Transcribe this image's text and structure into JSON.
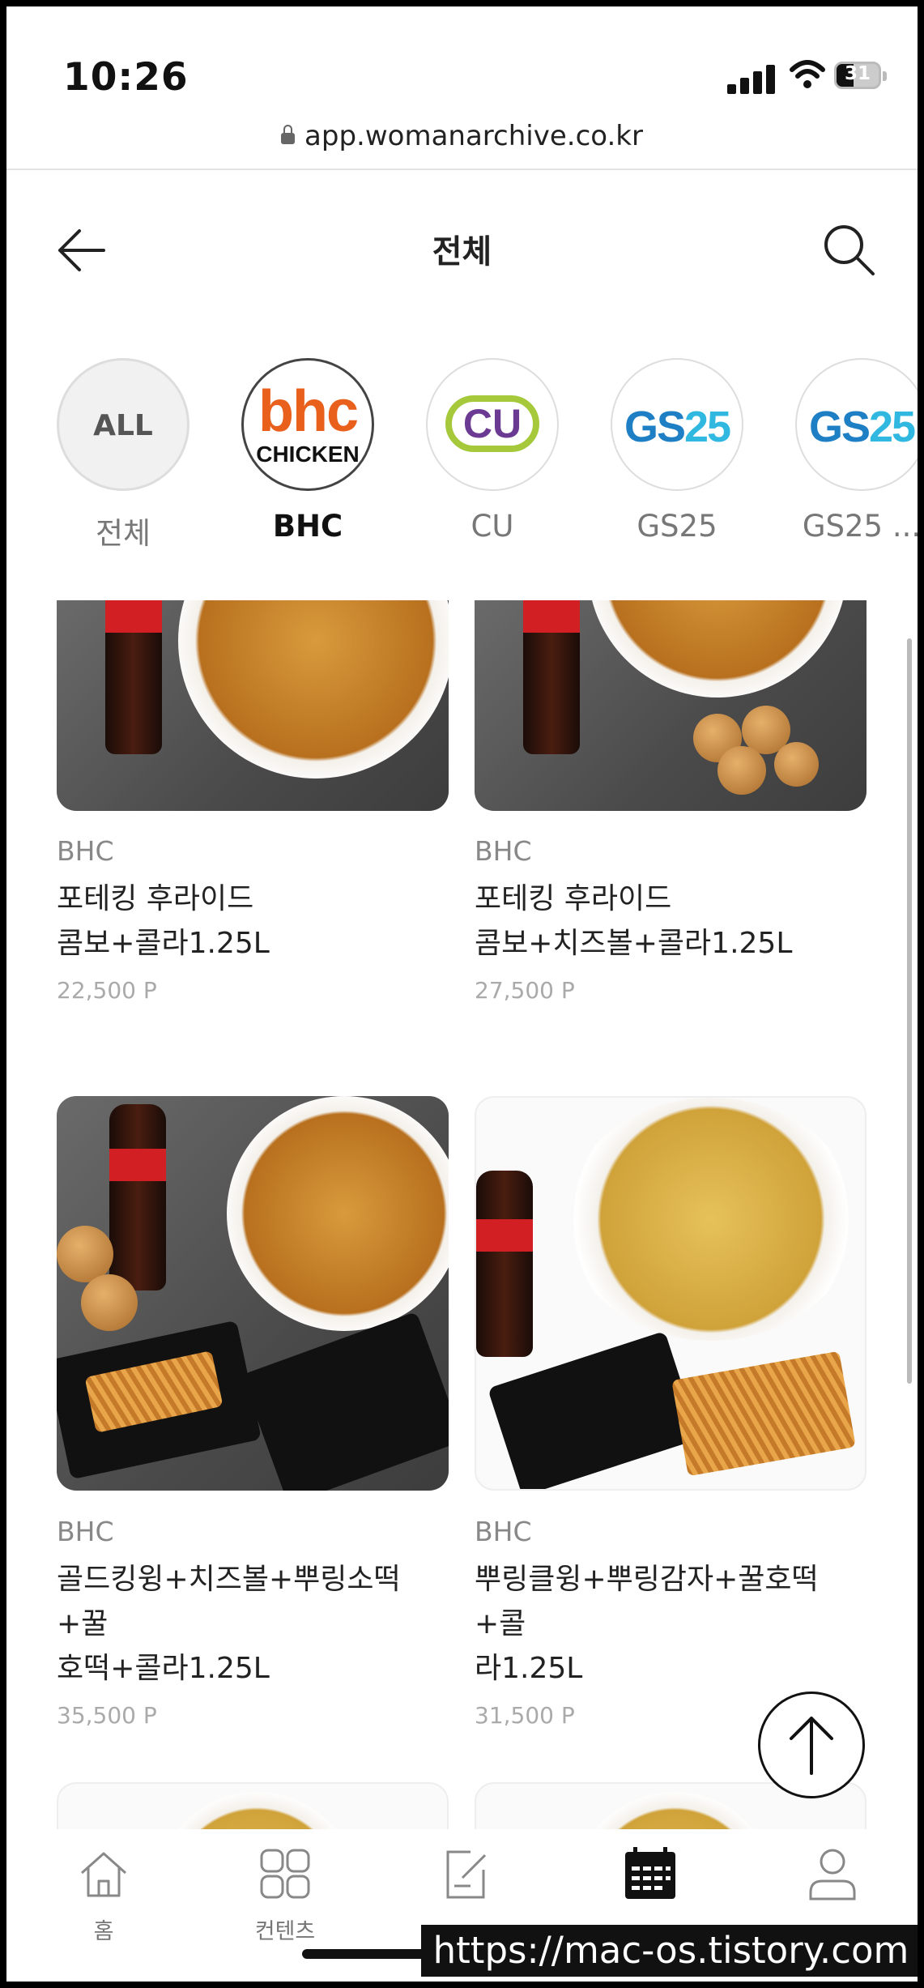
{
  "status_bar": {
    "time": "10:26",
    "battery": "31"
  },
  "url": "app.womanarchive.co.kr",
  "header": {
    "title": "전체"
  },
  "brands": [
    {
      "logo": "ALL",
      "label": "전체",
      "selected": false
    },
    {
      "logo": "bhc",
      "logo_sub": "CHICKEN",
      "label": "BHC",
      "selected": true
    },
    {
      "logo": "CU",
      "label": "CU",
      "selected": false
    },
    {
      "logo": "GS25",
      "label": "GS25",
      "selected": false
    },
    {
      "logo": "GS25",
      "label": "GS25 ...",
      "selected": false
    }
  ],
  "products": [
    {
      "brand": "BHC",
      "name_line1": "포테킹 후라이드",
      "name_line2": "콤보+콜라1.25L",
      "price": "22,500 P"
    },
    {
      "brand": "BHC",
      "name_line1": "포테킹 후라이드",
      "name_line2": "콤보+치즈볼+콜라1.25L",
      "price": "27,500 P"
    },
    {
      "brand": "BHC",
      "name_line1": "골드킹윙+치즈볼+뿌링소떡+꿀",
      "name_line2": "호떡+콜라1.25L",
      "price": "35,500 P"
    },
    {
      "brand": "BHC",
      "name_line1": "뿌링클윙+뿌링감자+꿀호떡+콜",
      "name_line2": "라1.25L",
      "price": "31,500 P"
    }
  ],
  "tabbar": {
    "items": [
      {
        "label": "홈",
        "icon": "home-icon"
      },
      {
        "label": "컨텐츠",
        "icon": "grid-icon"
      },
      {
        "label": "",
        "icon": "edit-note-icon"
      },
      {
        "label": "",
        "icon": "calendar-icon",
        "active": true
      },
      {
        "label": "",
        "icon": "person-icon"
      }
    ]
  },
  "watermark": "https://mac-os.tistory.com"
}
